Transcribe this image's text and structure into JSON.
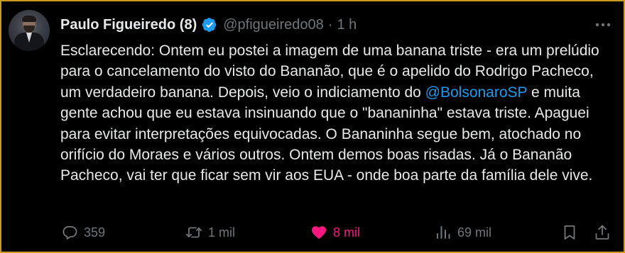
{
  "post": {
    "author_name": "Paulo Figueiredo (8)",
    "handle": "@pfigueiredo08",
    "separator": "·",
    "time": "1 h",
    "text_before_mention": "Esclarecendo: Ontem eu postei a imagem de uma banana triste - era um prelúdio para o cancelamento do visto do Bananão, que é o apelido do Rodrigo Pacheco, um verdadeiro banana. Depois, veio o indiciamento do ",
    "mention": "@BolsonaroSP",
    "text_after_mention": " e muita gente achou que eu estava insinuando que o \"bananinha\" estava triste. Apaguei para evitar interpretações equivocadas. O Bananinha segue bem, atochado no orifício do Moraes e vários outros. Ontem demos boas risadas. Já o Bananão Pacheco, vai ter que ficar sem vir aos EUA - onde boa parte da família dele vive."
  },
  "actions": {
    "replies": "359",
    "reposts": "1 mil",
    "likes": "8 mil",
    "views": "69 mil"
  },
  "icons": {
    "verified": "verified-badge-icon",
    "more": "more-options-icon",
    "reply": "reply-icon",
    "repost": "repost-icon",
    "like": "heart-icon",
    "views": "views-icon",
    "bookmark": "bookmark-icon",
    "share": "share-icon"
  },
  "colors": {
    "background": "#000000",
    "border": "#c99a1f",
    "text": "#e7e9ea",
    "muted": "#71767b",
    "accent": "#1d9bf0",
    "like": "#f91880"
  }
}
